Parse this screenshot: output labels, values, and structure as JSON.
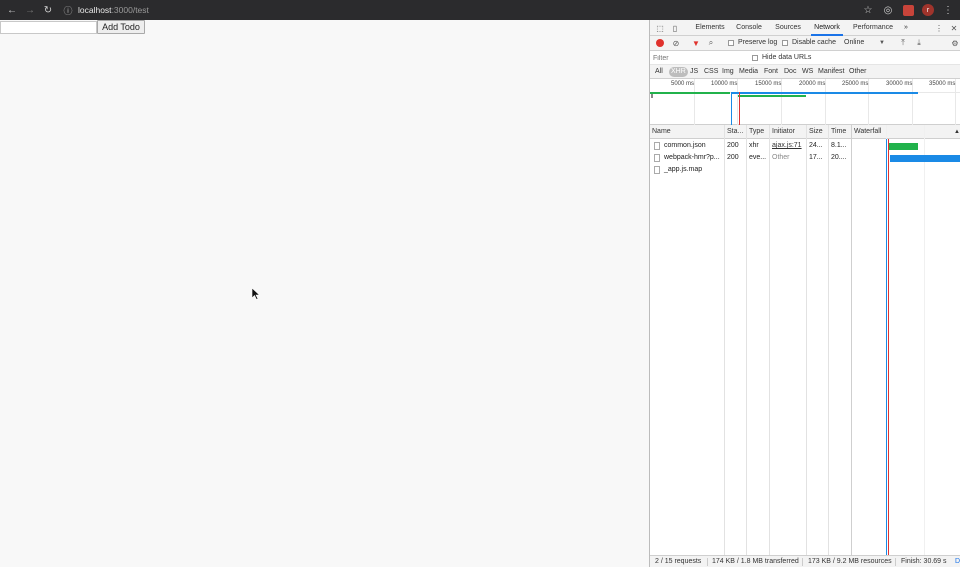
{
  "browser": {
    "url_host": "localhost",
    "url_path": ":3000/test",
    "avatar_initial": "r",
    "icons": [
      "back-arrow-icon",
      "forward-arrow-icon",
      "reload-icon",
      "info-icon",
      "star-icon",
      "extension-icon",
      "extension-red-icon",
      "menu-kebab-icon"
    ]
  },
  "page": {
    "todo_input_value": "",
    "add_button_label": "Add Todo"
  },
  "devtools": {
    "tabs": [
      "Elements",
      "Console",
      "Sources",
      "Network",
      "Performance",
      "»"
    ],
    "active_tab": "Network",
    "toolbar": {
      "preserve_log": "Preserve log",
      "disable_cache": "Disable cache",
      "throttle": "Online"
    },
    "filter_placeholder": "Filter",
    "hide_data_urls": "Hide data URLs",
    "type_filters": [
      "All",
      "XHR",
      "JS",
      "CSS",
      "Img",
      "Media",
      "Font",
      "Doc",
      "WS",
      "Manifest",
      "Other"
    ],
    "active_type": "XHR",
    "overview_ticks": [
      "5000 ms",
      "10000 ms",
      "15000 ms",
      "20000 ms",
      "25000 ms",
      "30000 ms",
      "35000 ms"
    ],
    "columns": [
      "Name",
      "Sta...",
      "Type",
      "Initiator",
      "Size",
      "Time",
      "Waterfall"
    ],
    "rows": [
      {
        "name": "common.json",
        "status": "200",
        "type": "xhr",
        "initiator": "ajax.js:71",
        "size": "24...",
        "time": "8.1..."
      },
      {
        "name": "webpack-hmr?p...",
        "status": "200",
        "type": "eve...",
        "initiator": "Other",
        "size": "17...",
        "time": "20...."
      },
      {
        "name": "_app.js.map",
        "status": "",
        "type": "",
        "initiator": "",
        "size": "",
        "time": ""
      }
    ],
    "status_bar": {
      "requests": "2 / 15 requests",
      "transferred": "174 KB / 1.8 MB transferred",
      "resources": "173 KB / 9.2 MB resources",
      "finish": "Finish: 30.69 s",
      "dom": "D"
    },
    "colors": {
      "record": "#e0322d",
      "waterfall_green": "#21b24b",
      "waterfall_blue": "#1a8ae6",
      "active_tab_underline": "#1a73e8"
    }
  }
}
